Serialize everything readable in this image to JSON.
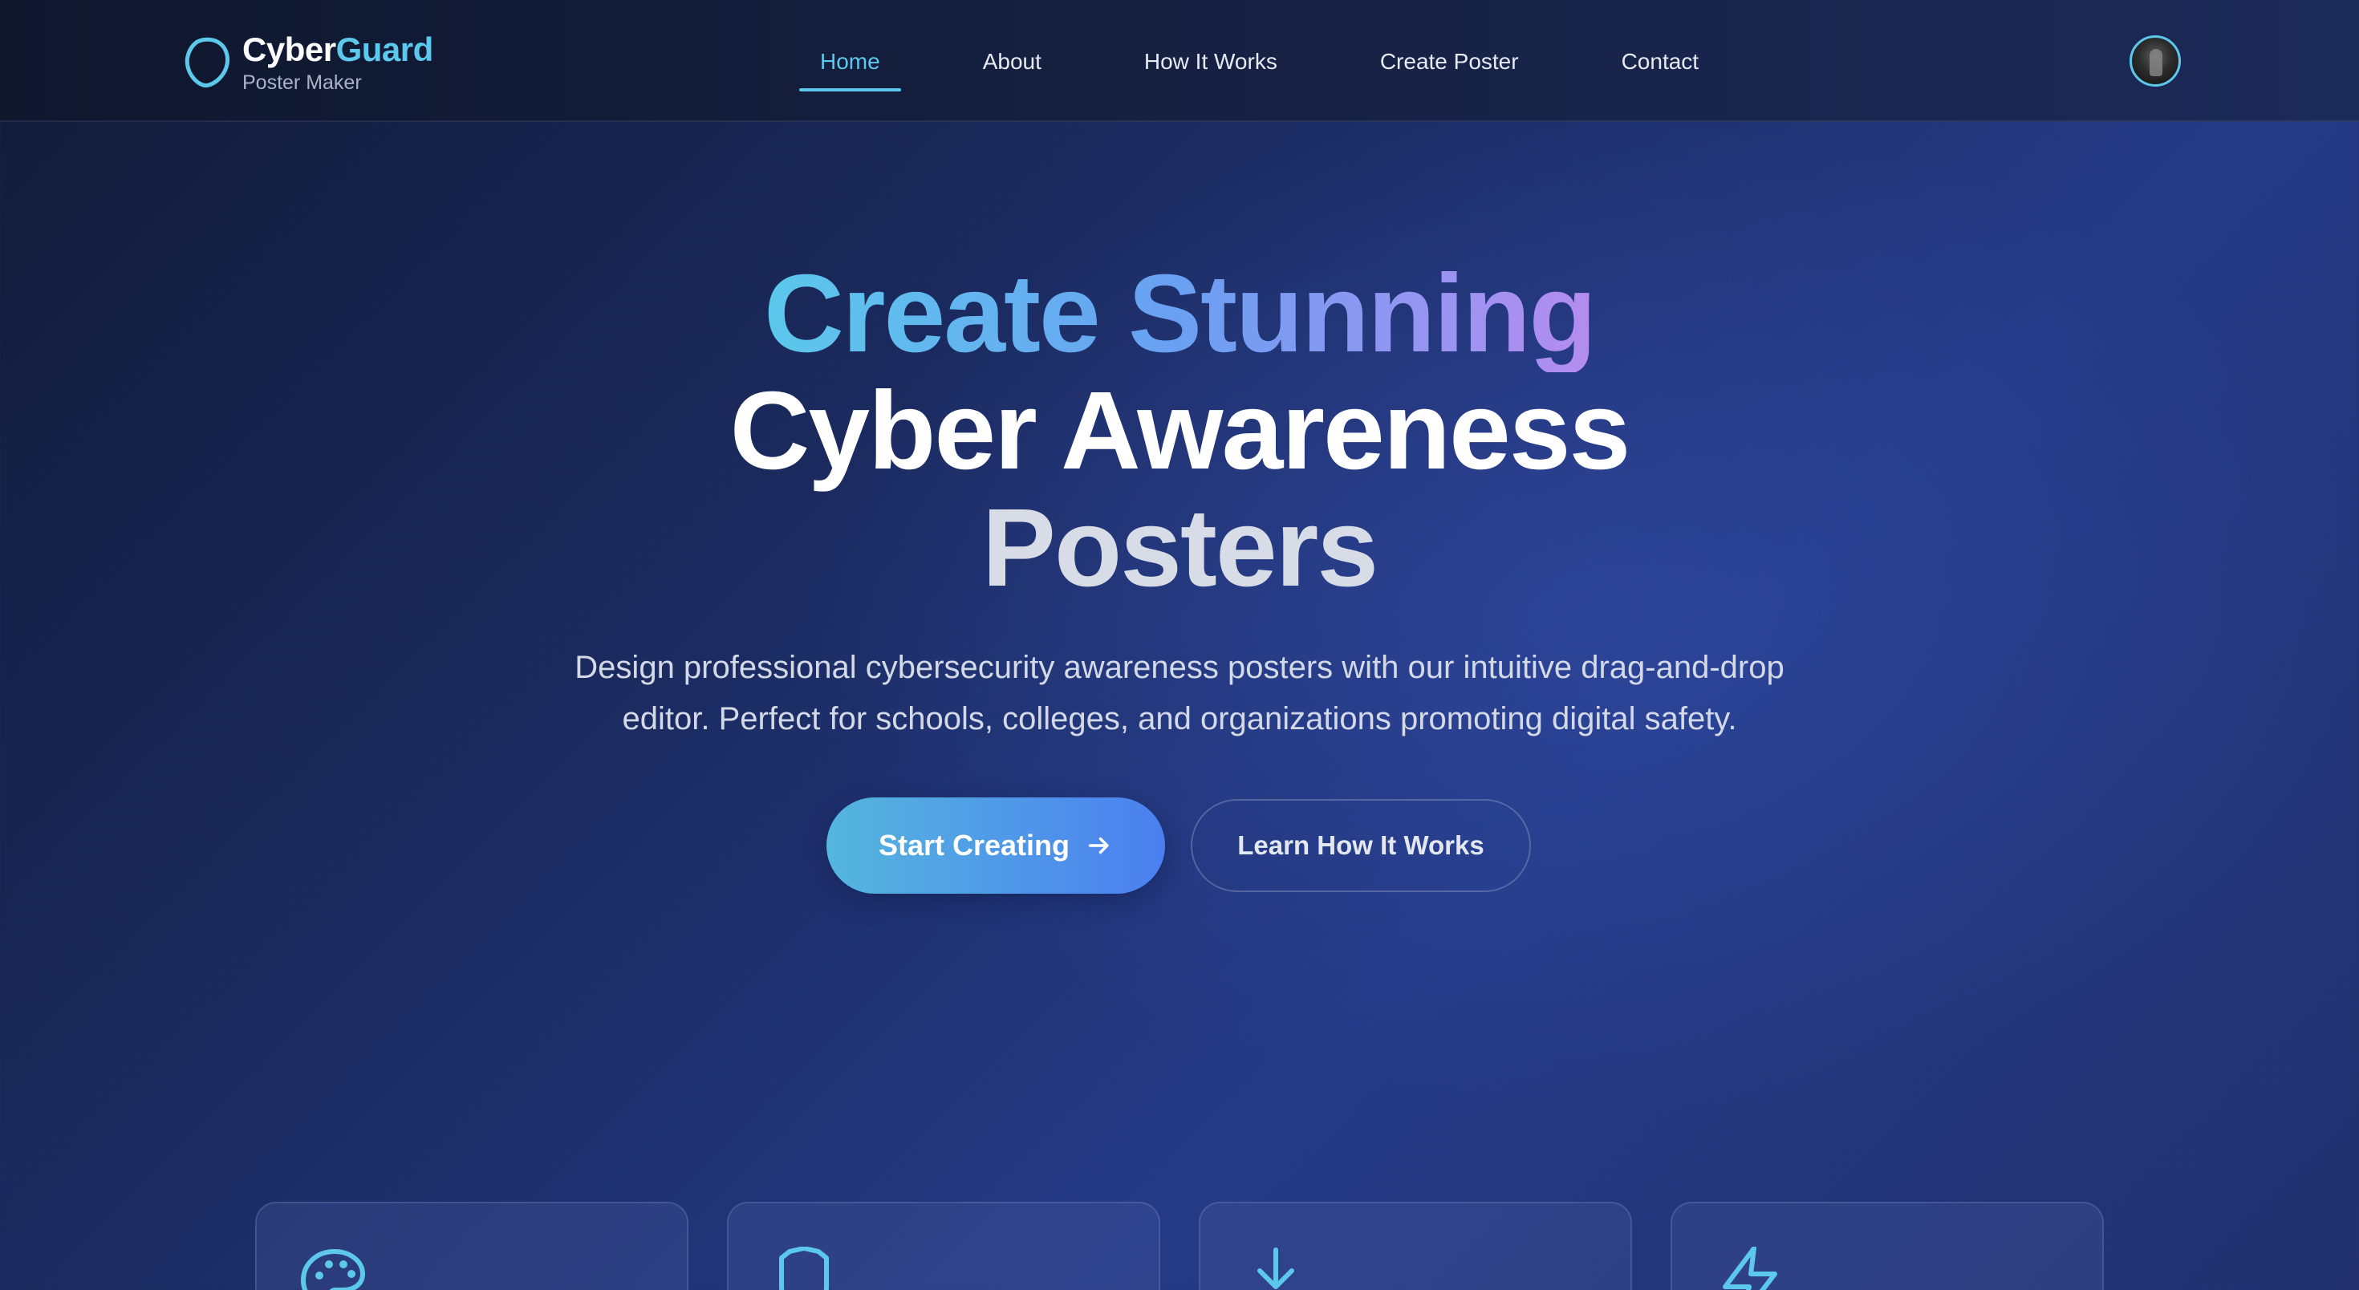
{
  "brand": {
    "title_part1": "Cyber",
    "title_part2": "Guard",
    "subtitle": "Poster Maker",
    "logo_icon": "shield-outline-icon"
  },
  "nav": {
    "items": [
      {
        "label": "Home",
        "active": true
      },
      {
        "label": "About",
        "active": false
      },
      {
        "label": "How It Works",
        "active": false
      },
      {
        "label": "Create Poster",
        "active": false
      },
      {
        "label": "Contact",
        "active": false
      }
    ],
    "avatar_icon": "user-avatar"
  },
  "hero": {
    "title_line1": "Create Stunning",
    "title_line2": "Cyber Awareness",
    "title_line3": "Posters",
    "description": "Design professional cybersecurity awareness posters with our intuitive drag-and-drop editor. Perfect for schools, colleges, and organizations promoting digital safety.",
    "primary_button": "Start Creating",
    "secondary_button": "Learn How It Works"
  },
  "features": [
    {
      "icon": "palette-icon"
    },
    {
      "icon": "shield-icon"
    },
    {
      "icon": "download-icon"
    },
    {
      "icon": "lightning-icon"
    }
  ],
  "colors": {
    "accent": "#5cc8ec",
    "gradient_start": "#5cc8ec",
    "gradient_mid": "#6aa0f2",
    "gradient_end": "#b58cf0",
    "button_end": "#4b7ff0",
    "background": "#1b2a5e"
  }
}
